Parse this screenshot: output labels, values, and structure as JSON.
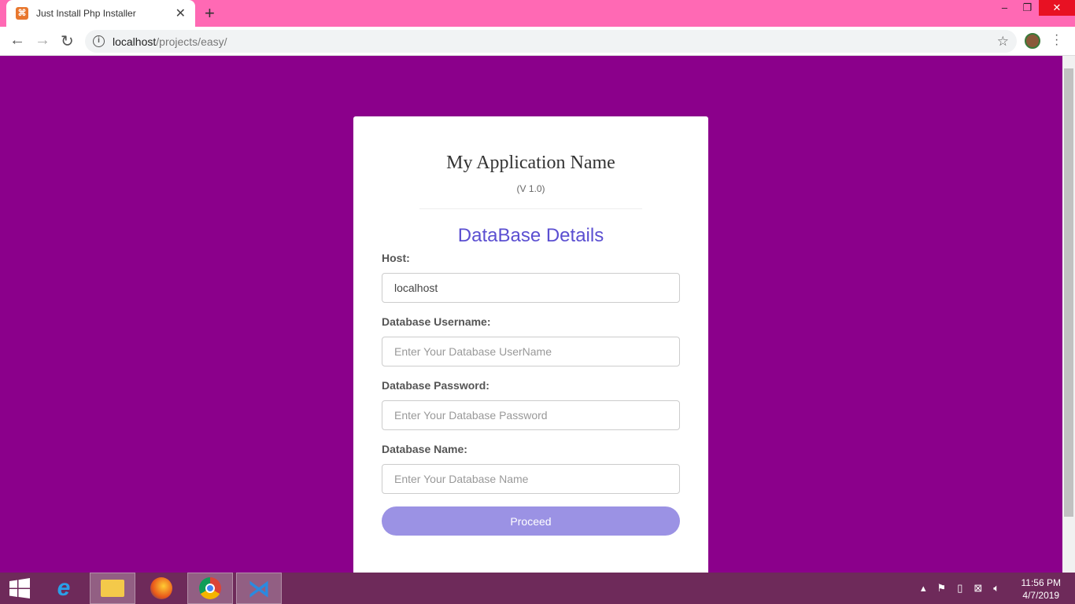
{
  "browser": {
    "tab_title": "Just Install Php Installer",
    "url_host": "localhost",
    "url_path": "/projects/easy/"
  },
  "card": {
    "app_name": "My Application Name",
    "version": "(V 1.0)",
    "section_title": "DataBase Details",
    "fields": [
      {
        "label": "Host:",
        "value": "localhost",
        "placeholder": ""
      },
      {
        "label": "Database Username:",
        "value": "",
        "placeholder": "Enter Your Database UserName"
      },
      {
        "label": "Database Password:",
        "value": "",
        "placeholder": "Enter Your Database Password"
      },
      {
        "label": "Database Name:",
        "value": "",
        "placeholder": "Enter Your Database Name"
      }
    ],
    "proceed_label": "Proceed"
  },
  "taskbar": {
    "time": "11:56 PM",
    "date": "4/7/2019"
  },
  "colors": {
    "page_bg": "#8b008b",
    "accent": "#5b4fd1",
    "button": "#9b92e4",
    "chrome_frame": "#ff69b4"
  }
}
